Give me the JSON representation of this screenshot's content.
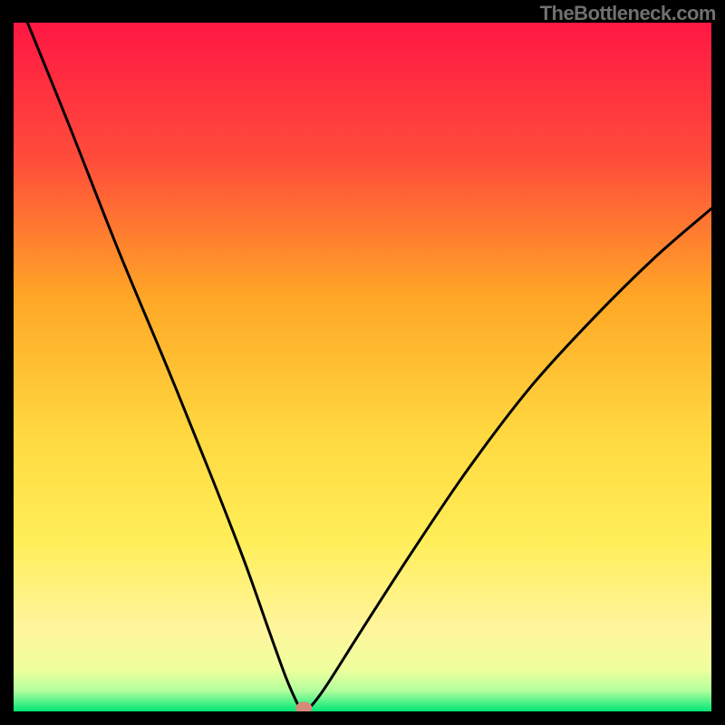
{
  "watermark": "TheBottleneck.com",
  "chart_data": {
    "type": "line",
    "title": "",
    "xlabel": "",
    "ylabel": "",
    "xlim": [
      0,
      100
    ],
    "ylim": [
      0,
      100
    ],
    "gradient_stops": [
      {
        "offset": 0,
        "color": "#ff1744"
      },
      {
        "offset": 20,
        "color": "#ff4d3a"
      },
      {
        "offset": 40,
        "color": "#ffa726"
      },
      {
        "offset": 60,
        "color": "#ffd940"
      },
      {
        "offset": 75,
        "color": "#ffee58"
      },
      {
        "offset": 88,
        "color": "#fff59d"
      },
      {
        "offset": 94,
        "color": "#eeff9d"
      },
      {
        "offset": 97,
        "color": "#b2ff9d"
      },
      {
        "offset": 100,
        "color": "#00e676"
      }
    ],
    "curve_points": [
      {
        "x": 2.0,
        "y": 100
      },
      {
        "x": 8,
        "y": 85
      },
      {
        "x": 15,
        "y": 67
      },
      {
        "x": 22,
        "y": 50
      },
      {
        "x": 28,
        "y": 35
      },
      {
        "x": 33,
        "y": 22
      },
      {
        "x": 36.5,
        "y": 12
      },
      {
        "x": 39,
        "y": 5
      },
      {
        "x": 40.5,
        "y": 1.5
      },
      {
        "x": 41.2,
        "y": 0.3
      },
      {
        "x": 42.0,
        "y": 0.3
      },
      {
        "x": 43.0,
        "y": 1.2
      },
      {
        "x": 45,
        "y": 4
      },
      {
        "x": 50,
        "y": 12
      },
      {
        "x": 57,
        "y": 23
      },
      {
        "x": 65,
        "y": 35
      },
      {
        "x": 74,
        "y": 47
      },
      {
        "x": 83,
        "y": 57
      },
      {
        "x": 92,
        "y": 66
      },
      {
        "x": 100,
        "y": 73
      }
    ],
    "marker": {
      "x": 41.6,
      "y": 0.5,
      "color": "#d48a7a"
    }
  }
}
